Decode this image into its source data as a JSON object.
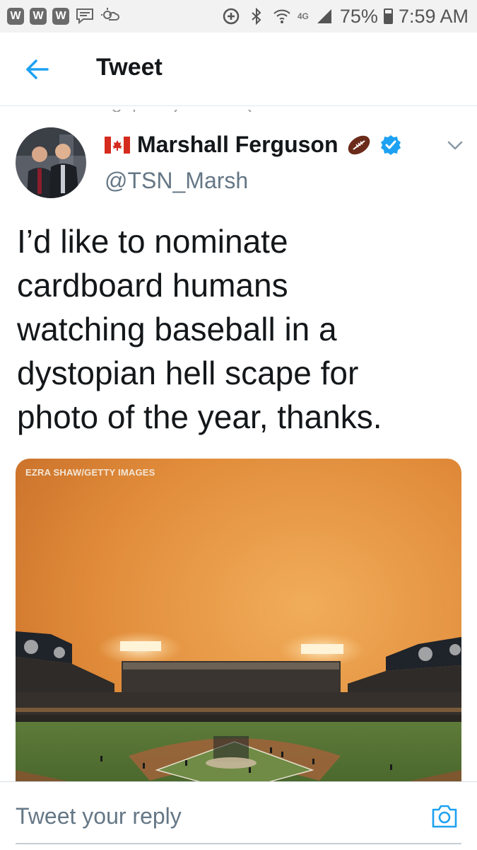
{
  "status_bar": {
    "notification_badges": [
      "W",
      "W",
      "W"
    ],
    "network": "4G",
    "battery_percent": "75%",
    "battery_level": 0.75,
    "time": "7:59 AM",
    "icons": [
      "message-icon",
      "weather-icon",
      "data-saver-icon",
      "bluetooth-icon",
      "wifi-icon",
      "signal-icon",
      "battery-icon"
    ]
  },
  "header": {
    "title": "Tweet",
    "back_icon": "back-arrow-icon"
  },
  "tweet": {
    "author_name": "Marshall Ferguson",
    "author_handle": "@TSN_Marsh",
    "name_emojis": [
      "canada-flag-icon",
      "football-icon"
    ],
    "verified": true,
    "text_lines": [
      "I’d like to nominate",
      "cardboard humans",
      "watching baseball in a",
      "dystopian hell scape for",
      "photo of the year, thanks."
    ],
    "photo_credit": "EZRA SHAW/GETTY IMAGES"
  },
  "reply_bar": {
    "placeholder": "Tweet your reply",
    "camera_icon": "camera-icon"
  },
  "colors": {
    "accent": "#1da1f2",
    "text": "#14171a",
    "secondary_text": "#657786",
    "sky": "#e79a45"
  }
}
